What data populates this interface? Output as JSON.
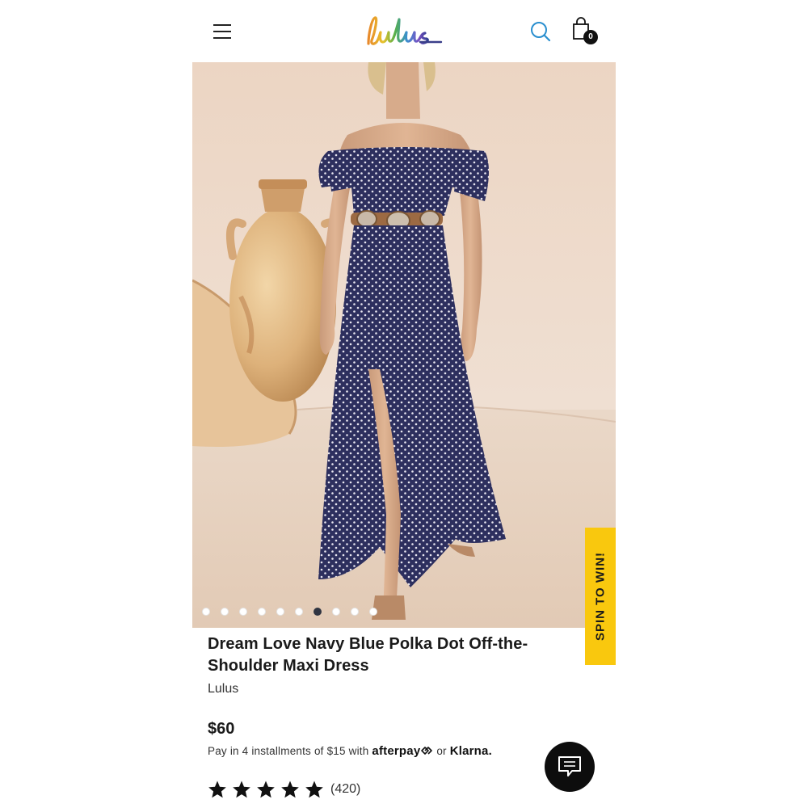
{
  "header": {
    "logo_text": "Lulus",
    "cart_count": "0",
    "icons": [
      "hamburger-menu-icon",
      "search-icon",
      "shopping-bag-icon"
    ]
  },
  "gallery": {
    "slide_count": 10,
    "active_slide": 7
  },
  "promo": {
    "spin_label": "SPIN TO WIN!",
    "color": "#f9c80e"
  },
  "product": {
    "title": "Dream Love Navy Blue Polka Dot Off-the-Shoulder Maxi Dress",
    "brand": "Lulus",
    "price": "$60",
    "installments_prefix": "Pay in 4 installments of $15 with",
    "afterpay_label": "afterpay",
    "or_text": "or",
    "klarna_label": "Klarna.",
    "rating": 5,
    "review_count": "(420)"
  },
  "colors": {
    "accent_search": "#2a8fcf",
    "text": "#1a1a1a",
    "dress_navy": "#2d2f5e"
  }
}
